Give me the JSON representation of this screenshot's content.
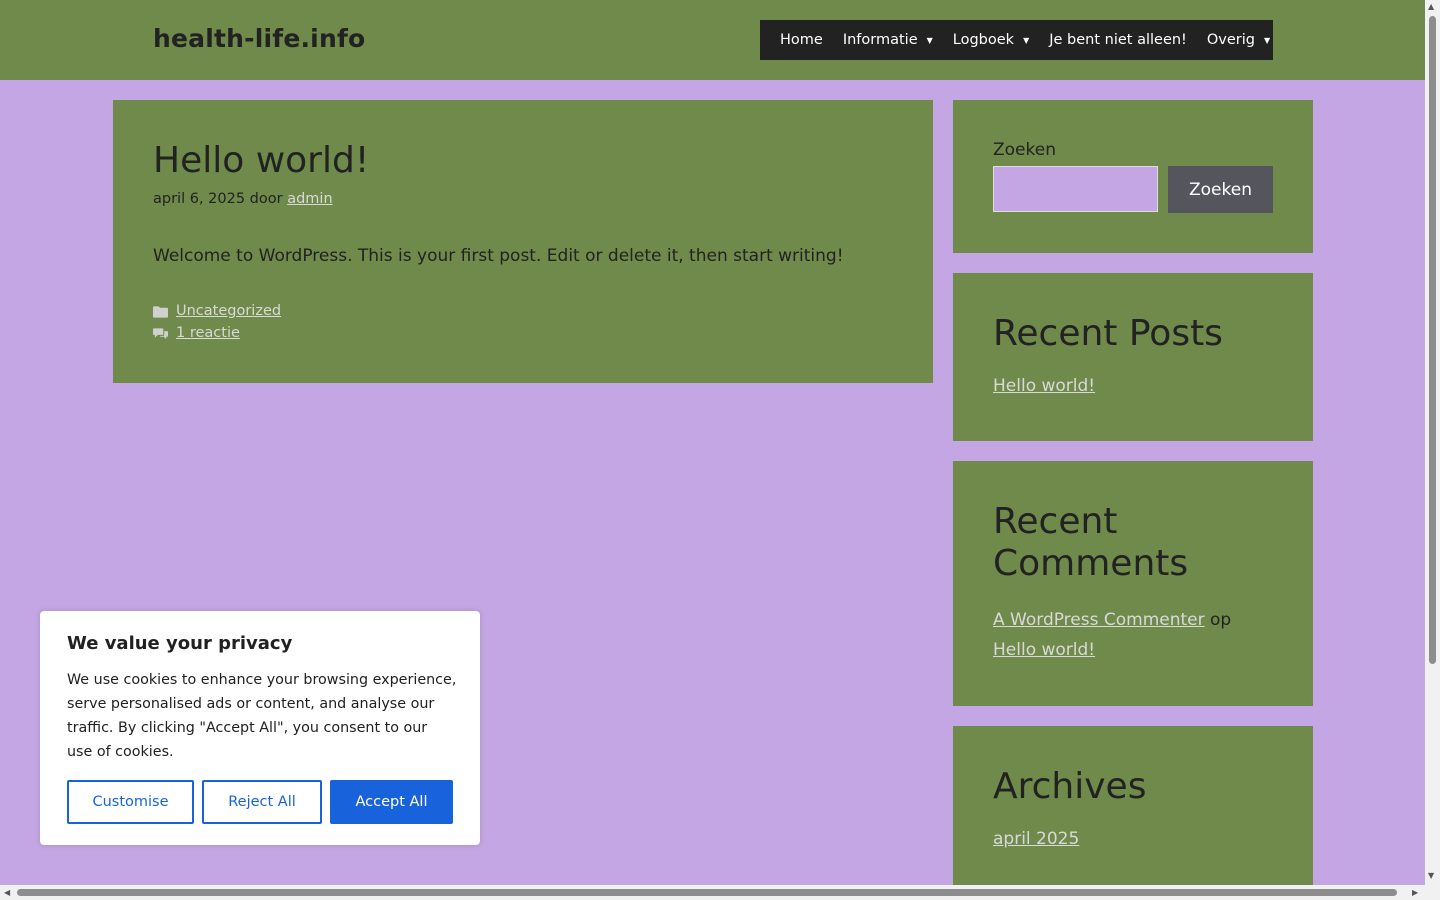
{
  "header": {
    "site_title": "health-life.info",
    "nav": [
      {
        "label": "Home"
      },
      {
        "label": "Informatie"
      },
      {
        "label": "Logboek"
      },
      {
        "label": "Je bent niet alleen!"
      },
      {
        "label": "Overig"
      }
    ],
    "dropdown_caret": "▼"
  },
  "post": {
    "title": "Hello world!",
    "date": "april 6, 2025",
    "by": "door",
    "author": "admin",
    "content": "Welcome to WordPress. This is your first post. Edit or delete it, then start writing!",
    "category": "Uncategorized",
    "comments": "1 reactie"
  },
  "sidebar": {
    "search": {
      "label": "Zoeken",
      "button": "Zoeken",
      "value": ""
    },
    "recent_posts": {
      "title": "Recent Posts",
      "items": [
        "Hello world!"
      ]
    },
    "recent_comments": {
      "title": "Recent Comments",
      "author": "A WordPress Commenter",
      "on": "op",
      "post": "Hello world!"
    },
    "archives": {
      "title": "Archives",
      "items": [
        "april 2025"
      ]
    }
  },
  "cookie": {
    "title": "We value your privacy",
    "text": "We use cookies to enhance your browsing experience, serve personalised ads or content, and analyse our traffic. By clicking \"Accept All\", you consent to our use of cookies.",
    "customise": "Customise",
    "reject": "Reject All",
    "accept": "Accept All"
  },
  "colors": {
    "page_bg": "#c3a6e3",
    "green": "#6f8a4a",
    "nav_bg": "#222222",
    "accent_blue": "#1863dc"
  }
}
